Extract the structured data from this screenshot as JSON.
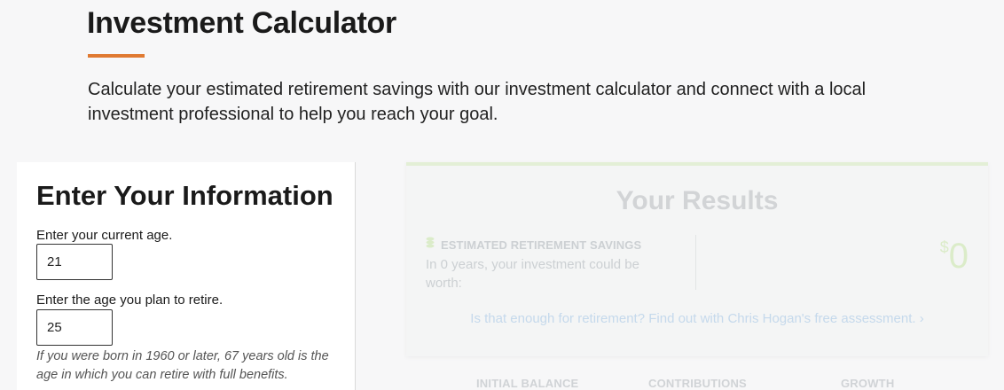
{
  "header": {
    "title": "Investment Calculator",
    "intro": "Calculate your estimated retirement savings with our investment calculator and connect with a local investment professional to help you reach your goal."
  },
  "input_panel": {
    "heading": "Enter Your Information",
    "current_age_label": "Enter your current age.",
    "current_age_value": "21",
    "retire_age_label": "Enter the age you plan to retire.",
    "retire_age_value": "25",
    "retire_note": "If you were born in 1960 or later, 67 years old is the age in which you can retire with full benefits."
  },
  "results": {
    "heading": "Your Results",
    "savings_label": "ESTIMATED RETIREMENT SAVINGS",
    "savings_desc": "In 0 years, your investment could be worth:",
    "currency_symbol": "$",
    "amount": "0",
    "assessment_link": "Is that enough for retirement? Find out with Chris Hogan's free assessment. ›",
    "columns": [
      "INITIAL BALANCE",
      "CONTRIBUTIONS",
      "GROWTH"
    ]
  },
  "icons": {
    "savings": "coins-icon"
  },
  "colors": {
    "accent": "#e07a32",
    "results_top_border": "#e3efd6",
    "link_faded": "#c5d9ec",
    "amount_faded": "#dbecc9"
  }
}
